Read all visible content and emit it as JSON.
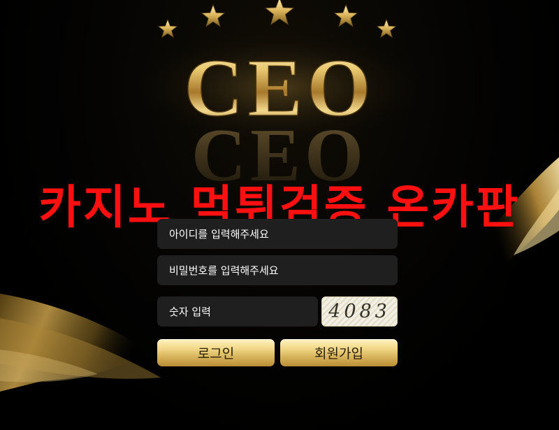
{
  "brand": {
    "logo_text": "CEO",
    "star_count": 5
  },
  "watermark": {
    "text": "카지노 먹튀검증 온카판",
    "color": "#ff1010"
  },
  "login_form": {
    "id_placeholder": "아이디를 입력해주세요",
    "password_placeholder": "비밀번호를 입력해주세요",
    "code_placeholder": "숫자 입력",
    "captcha_text": "4083",
    "login_button": "로그인",
    "signup_button": "회원가입"
  },
  "colors": {
    "background": "#000000",
    "gold": "#d8b45c",
    "input_background": "#1f1f20"
  }
}
